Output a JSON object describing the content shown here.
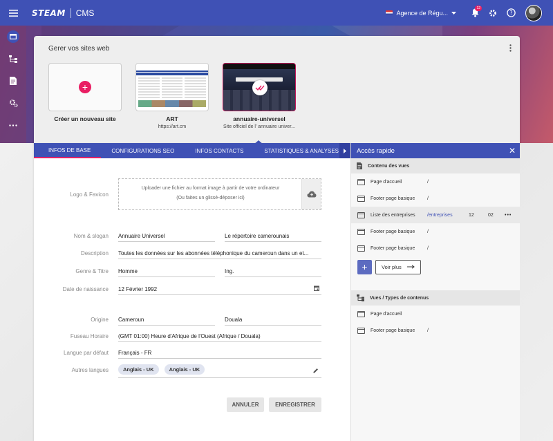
{
  "topbar": {
    "brand": "STEAM",
    "app": "CMS",
    "agency": "Agence de Régu...",
    "notifications": "12"
  },
  "sites": {
    "title": "Gerer vos sites web",
    "items": [
      {
        "name": "Créer un nouveau site",
        "url": ""
      },
      {
        "name": "ART",
        "url": "https://art.cm"
      },
      {
        "name": "annuaire-universel",
        "url": "Site officiel de l'  annuaire univer..."
      }
    ]
  },
  "tabs": [
    {
      "label": "INFOS DE BASE"
    },
    {
      "label": "CONFIGURATIONS SEO"
    },
    {
      "label": "INFOS CONTACTS"
    },
    {
      "label": "STATISTIQUES & ANALYSES"
    }
  ],
  "form": {
    "logo_label": "Logo & Favicon",
    "upload_line1": "Uploader une fichier au format image à partir de votre ordinateur",
    "upload_line2": "(Ou faites un glissé-déposer ici)",
    "name_label": "Nom & slogan",
    "name": "Annuaire Universel",
    "slogan": "Le répertoire camerounais",
    "description_label": "Description",
    "description": "Toutes les données sur les abonnées téléphonique du cameroun dans un et...",
    "genre_label": "Genre & Titre",
    "genre": "Homme",
    "title": "Ing.",
    "birth_label": "Date de naissance",
    "birth": "12 Février 1992",
    "origin_label": "Origine",
    "country": "Cameroun",
    "city": "Douala",
    "timezone_label": "Fuseau Horaire",
    "timezone": "(GMT 01:00) Heure d'Afrique de l'Ouest (Afrique / Douala)",
    "lang_label": "Langue par défaut",
    "lang": "Français - FR",
    "other_lang_label": "Autres langues",
    "other_langs": [
      "Anglais - UK",
      "Anglais - UK"
    ],
    "cancel": "ANNULER",
    "save": "ENREGISTRER"
  },
  "quick": {
    "title": "Accès rapide",
    "content_title": "Contenu des vues",
    "content_rows": [
      {
        "label": "Page d'accueil",
        "path": "/",
        "n1": "",
        "n2": ""
      },
      {
        "label": "Footer page basique",
        "path": "/",
        "n1": "",
        "n2": ""
      },
      {
        "label": "Liste des entreprises",
        "path": "/entreprises",
        "n1": "12",
        "n2": "02"
      },
      {
        "label": "Footer page basique",
        "path": "/",
        "n1": "",
        "n2": ""
      },
      {
        "label": "Footer page basique",
        "path": "/",
        "n1": "",
        "n2": ""
      }
    ],
    "see_more": "Voir plus",
    "types_title": "Vues / Types de contenus",
    "types_rows": [
      {
        "label": "Page d'accueil",
        "path": ""
      },
      {
        "label": "Footer page basique",
        "path": "/"
      }
    ]
  },
  "colors": {
    "primary": "#3f51b5",
    "accent": "#e91e63"
  }
}
